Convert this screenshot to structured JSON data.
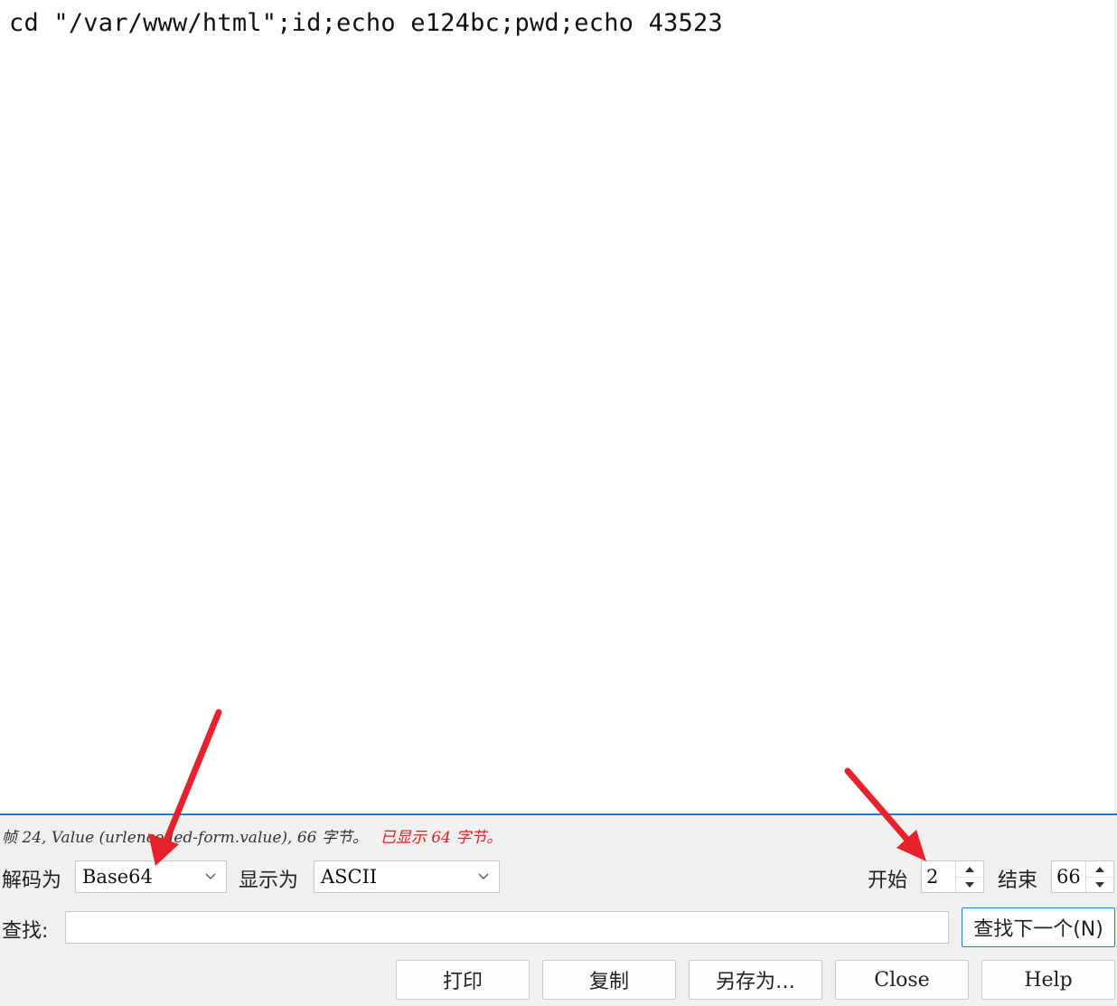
{
  "content": {
    "text": "cd \"/var/www/html\";id;echo e124bc;pwd;echo 43523"
  },
  "status": {
    "info": "帧 24, Value (urlencoded-form.value), 66 字节。",
    "warning": "已显示 64 字节。"
  },
  "controls": {
    "decode_label": "解码为",
    "decode_value": "Base64",
    "display_label": "显示为",
    "display_value": "ASCII",
    "start_label": "开始",
    "start_value": "2",
    "end_label": "结束",
    "end_value": "66"
  },
  "search": {
    "label": "查找:",
    "value": "",
    "find_next_label": "查找下一个(N)"
  },
  "buttons": {
    "print": "打印",
    "copy": "复制",
    "save_as": "另存为…",
    "close": "Close",
    "help": "Help"
  },
  "colors": {
    "accent": "#2b79c2",
    "warning": "#e02020",
    "annotation_arrow": "#e8222c"
  }
}
